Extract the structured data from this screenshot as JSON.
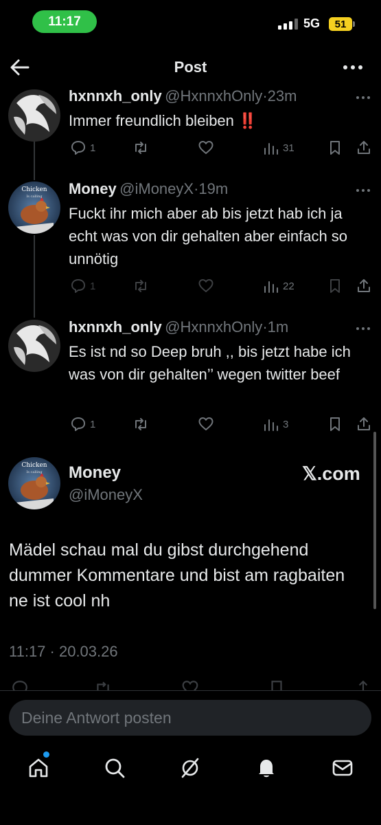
{
  "status_bar": {
    "time": "11:17",
    "network": "5G",
    "battery": "51"
  },
  "header": {
    "title": "Post"
  },
  "replies": [
    {
      "name": "hxnnxh_only",
      "handle": "@HxnnxhOnly",
      "time": "23m",
      "text": "Immer freundlich bleiben ‼️",
      "stats": {
        "replies": "1",
        "views": "31"
      }
    },
    {
      "name": "Money",
      "handle": "@iMoneyX",
      "time": "19m",
      "text": "Fuckt ihr mich aber ab bis jetzt hab ich ja echt was von dir gehalten aber einfach so unnötig",
      "avatar_text": "Chicken",
      "avatar_subtext": "Is calling",
      "stats": {
        "replies": "1",
        "views": "22"
      }
    },
    {
      "name": "hxnnxh_only",
      "handle": "@HxnnxhOnly",
      "time": "1m",
      "text": "Es ist nd so Deep bruh ,, bis jetzt habe ich was von dir gehalten’’ wegen twitter beef",
      "stats": {
        "replies": "1",
        "views": "3"
      }
    }
  ],
  "main_post": {
    "name": "Money",
    "handle": "@iMoneyX",
    "source": "𝕏.com",
    "avatar_text": "Chicken",
    "avatar_subtext": "Is calling",
    "text": "Mädel schau mal du gibst durchgehend dummer Kommentare und bist am ragbaiten ne ist cool nh",
    "timestamp": "11:17 · 20.03.26"
  },
  "reply_bar": {
    "placeholder": "Deine Antwort posten"
  },
  "colors": {
    "background": "#000000",
    "text": "#e7e9ea",
    "muted": "#71767b",
    "accent": "#1d9bf0",
    "time_pill": "#30c048",
    "battery": "#f5d020"
  },
  "icons": [
    "back-arrow-icon",
    "more-icon",
    "reply-icon",
    "repost-icon",
    "like-icon",
    "views-icon",
    "bookmark-icon",
    "share-icon",
    "home-icon",
    "search-icon",
    "grok-icon",
    "notifications-icon",
    "messages-icon"
  ]
}
